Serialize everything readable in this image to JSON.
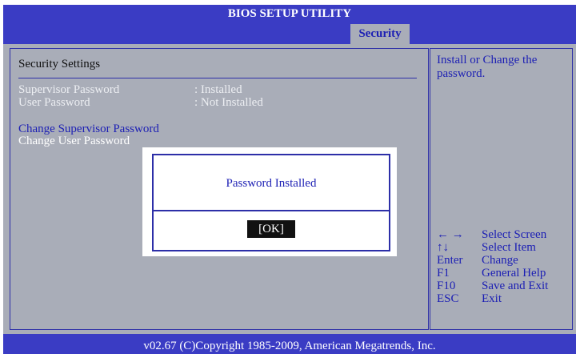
{
  "header": {
    "title": "BIOS SETUP UTILITY"
  },
  "tabs": [
    {
      "label": "Security"
    }
  ],
  "main": {
    "section_title": "Security Settings",
    "status": [
      {
        "label": "Supervisor Password",
        "value": ": Installed"
      },
      {
        "label": "User Password",
        "value": ": Not Installed"
      }
    ],
    "options": [
      {
        "label": "Change Supervisor Password"
      },
      {
        "label": "Change User Password"
      }
    ]
  },
  "help": {
    "text": "Install or Change the password.",
    "keys": [
      {
        "key": "← →",
        "action": "Select Screen"
      },
      {
        "key": "↑↓",
        "action": "Select Item"
      },
      {
        "key": "Enter",
        "action": "Change"
      },
      {
        "key": "F1",
        "action": "General Help"
      },
      {
        "key": "F10",
        "action": "Save and Exit"
      },
      {
        "key": "ESC",
        "action": "Exit"
      }
    ]
  },
  "dialog": {
    "message": "Password Installed",
    "ok_label": "[OK]"
  },
  "footer": {
    "text": "v02.67 (C)Copyright 1985-2009, American Megatrends, Inc."
  },
  "colors": {
    "title_bar": "#3a3cc4",
    "panel": "#a9adb8",
    "text_blue": "#1c1fb4",
    "border": "#2d2fa8"
  }
}
